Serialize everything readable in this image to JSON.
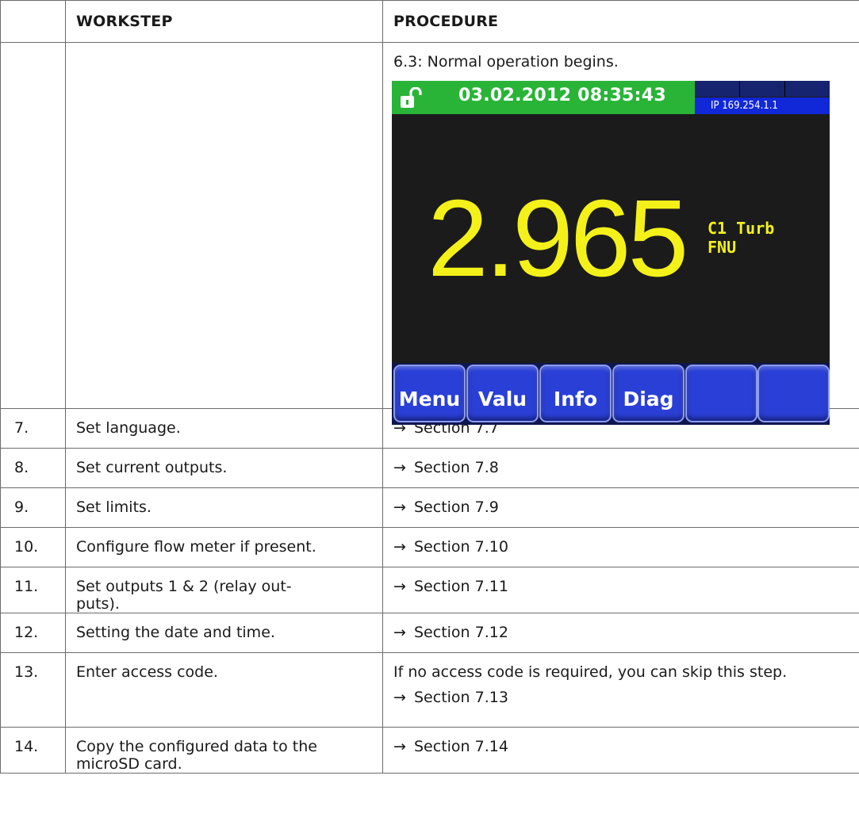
{
  "header": {
    "col1": "",
    "col2": "WORKSTEP",
    "col3": "PROCEDURE"
  },
  "screen_row": {
    "caption": "6.3: Normal operation begins.",
    "device": {
      "datetime": "03.02.2012  08:35:43",
      "ip": "IP  169.254.1.1",
      "value": "2.965",
      "channel": "C1  Turb",
      "unit": "FNU",
      "softkeys": [
        "Menu",
        "Valu",
        "Info",
        "Diag",
        "",
        ""
      ],
      "colors": {
        "status_bar": "#29b438",
        "value_text": "#f3f119",
        "key": "#2a3fd6",
        "ip_bar": "#1028d8"
      },
      "icons": {
        "lock": "unlocked-padlock-icon"
      }
    }
  },
  "rows": [
    {
      "num": "7.",
      "step": "Set language.",
      "arrow": "→",
      "proc": "Section 7.7"
    },
    {
      "num": "8.",
      "step": "Set current outputs.",
      "arrow": "→",
      "proc": "Section 7.8"
    },
    {
      "num": "9.",
      "step": "Set limits.",
      "arrow": "→",
      "proc": "Section 7.9"
    },
    {
      "num": "10.",
      "step": "Configure flow meter if present.",
      "arrow": "→",
      "proc": "Section 7.10"
    },
    {
      "num": "11.",
      "step_line1": "Set outputs 1 & 2 (relay out-",
      "step_line2": "puts).",
      "arrow": "→",
      "proc": "Section 7.11"
    },
    {
      "num": "12.",
      "step": "Setting the date and time.",
      "arrow": "→",
      "proc": "Section 7.12"
    },
    {
      "num": "13.",
      "step": "Enter access code.",
      "proc_note": "If no access code is required, you can skip this step.",
      "arrow": "→",
      "proc": "Section 7.13"
    },
    {
      "num": "14.",
      "step_line1": "Copy the configured data to the",
      "step_line2": "microSD card.",
      "arrow": "→",
      "proc": "Section 7.14"
    }
  ]
}
